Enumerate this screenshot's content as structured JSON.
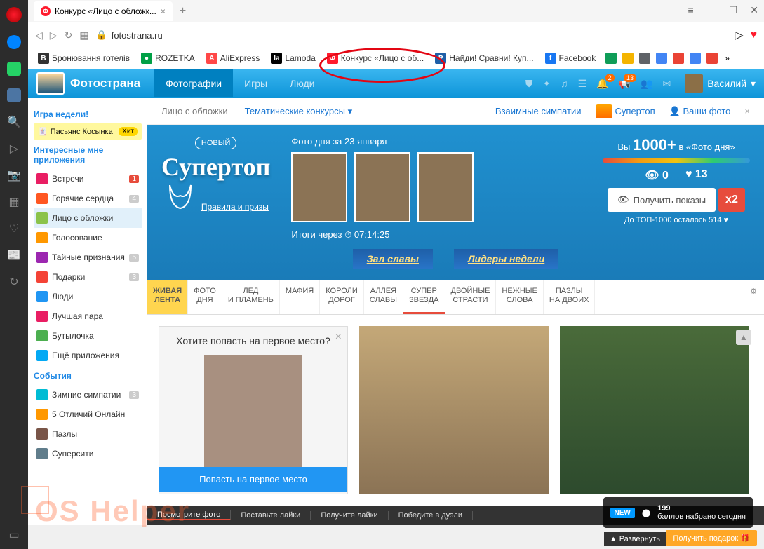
{
  "browser": {
    "tab_title": "Конкурс «Лицо с обложк...",
    "url": "fotostrana.ru"
  },
  "bookmarks": [
    {
      "label": "Бронювання готелів",
      "icon_bg": "#333",
      "icon_text": "B"
    },
    {
      "label": "ROZETKA",
      "icon_bg": "#00a046",
      "icon_text": "●"
    },
    {
      "label": "AliExpress",
      "icon_bg": "#ff4747",
      "icon_text": "A"
    },
    {
      "label": "Lamoda",
      "icon_bg": "#000",
      "icon_text": "la"
    },
    {
      "label": "Конкурс «Лицо с об...",
      "icon_bg": "#ff1b2d",
      "icon_text": "Ф"
    },
    {
      "label": "Найди! Сравни! Куп...",
      "icon_bg": "#1e5fa8",
      "icon_text": "P"
    },
    {
      "label": "Facebook",
      "icon_bg": "#1877f2",
      "icon_text": "f"
    }
  ],
  "header": {
    "site_name": "Фотострана",
    "nav": [
      "Фотографии",
      "Игры",
      "Люди"
    ],
    "notif1": "2",
    "notif2": "13",
    "username": "Василий"
  },
  "sidebar": {
    "game_week_title": "Игра недели!",
    "game_week_item": "Пасьянс Косынка",
    "hit": "Хит",
    "apps_title": "Интересные мне приложения",
    "items": [
      {
        "label": "Встречи",
        "count": "1",
        "red": true,
        "ico": "#e91e63"
      },
      {
        "label": "Горячие сердца",
        "count": "4",
        "ico": "#ff5722"
      },
      {
        "label": "Лицо с обложки",
        "count": "",
        "active": true,
        "ico": "#8bc34a"
      },
      {
        "label": "Голосование",
        "count": "",
        "ico": "#ff9800"
      },
      {
        "label": "Тайные признания",
        "count": "5",
        "ico": "#9c27b0"
      },
      {
        "label": "Подарки",
        "count": "3",
        "ico": "#f44336"
      },
      {
        "label": "Люди",
        "count": "",
        "ico": "#2196f3"
      },
      {
        "label": "Лучшая пара",
        "count": "",
        "ico": "#e91e63"
      },
      {
        "label": "Бутылочка",
        "count": "",
        "ico": "#4caf50"
      },
      {
        "label": "Ещё приложения",
        "count": "",
        "ico": "#03a9f4"
      }
    ],
    "events_title": "События",
    "events": [
      {
        "label": "Зимние симпатии",
        "count": "3",
        "ico": "#00bcd4"
      },
      {
        "label": "5 Отличий Онлайн",
        "count": "",
        "ico": "#ff9800"
      },
      {
        "label": "Пазлы",
        "count": "",
        "ico": "#795548"
      },
      {
        "label": "Суперсити",
        "count": "",
        "ico": "#607d8b"
      }
    ]
  },
  "subnav": {
    "link1": "Лицо с обложки",
    "link2": "Тематические конкурсы",
    "link3": "Взаимные симпатии",
    "link4": "Супертоп",
    "link5": "Ваши фото"
  },
  "hero": {
    "novyi": "НОВЫЙ",
    "title": "Супертоп",
    "rules": "Правила и призы",
    "photo_day": "Фото дня за 23 января",
    "countdown_label": "Итоги через",
    "countdown": "07:14:25",
    "you_in": "Вы",
    "you_count": "1000+",
    "you_in2": "в «Фото дня»",
    "views": "0",
    "likes": "13",
    "get_views": "Получить показы",
    "x2": "x2",
    "top1000": "До ТОП-1000 осталось 514",
    "ribbon1": "Зал славы",
    "ribbon2": "Лидеры недели"
  },
  "tabs": [
    "ЖИВАЯ ЛЕНТА",
    "ФОТО ДНЯ",
    "ЛЕД И ПЛАМЕНЬ",
    "МАФИЯ",
    "КОРОЛИ ДОРОГ",
    "АЛЛЕЯ СЛАВЫ",
    "СУПЕР ЗВЕЗДА",
    "ДВОЙНЫЕ СТРАСТИ",
    "НЕЖНЫЕ СЛОВА",
    "ПАЗЛЫ НА ДВОИХ"
  ],
  "promo": {
    "title": "Хотите попасть на первое место?",
    "button": "Попасть на первое место"
  },
  "bottom": {
    "items": [
      "Посмотрите фото",
      "Поставьте лайки",
      "Получите лайки",
      "Победите в дуэли"
    ],
    "new": "NEW",
    "points": "199",
    "points_label": "баллов набрано сегодня",
    "expand": "Развернуть",
    "gift": "Получить подарок"
  },
  "watermark": "OS Helper"
}
